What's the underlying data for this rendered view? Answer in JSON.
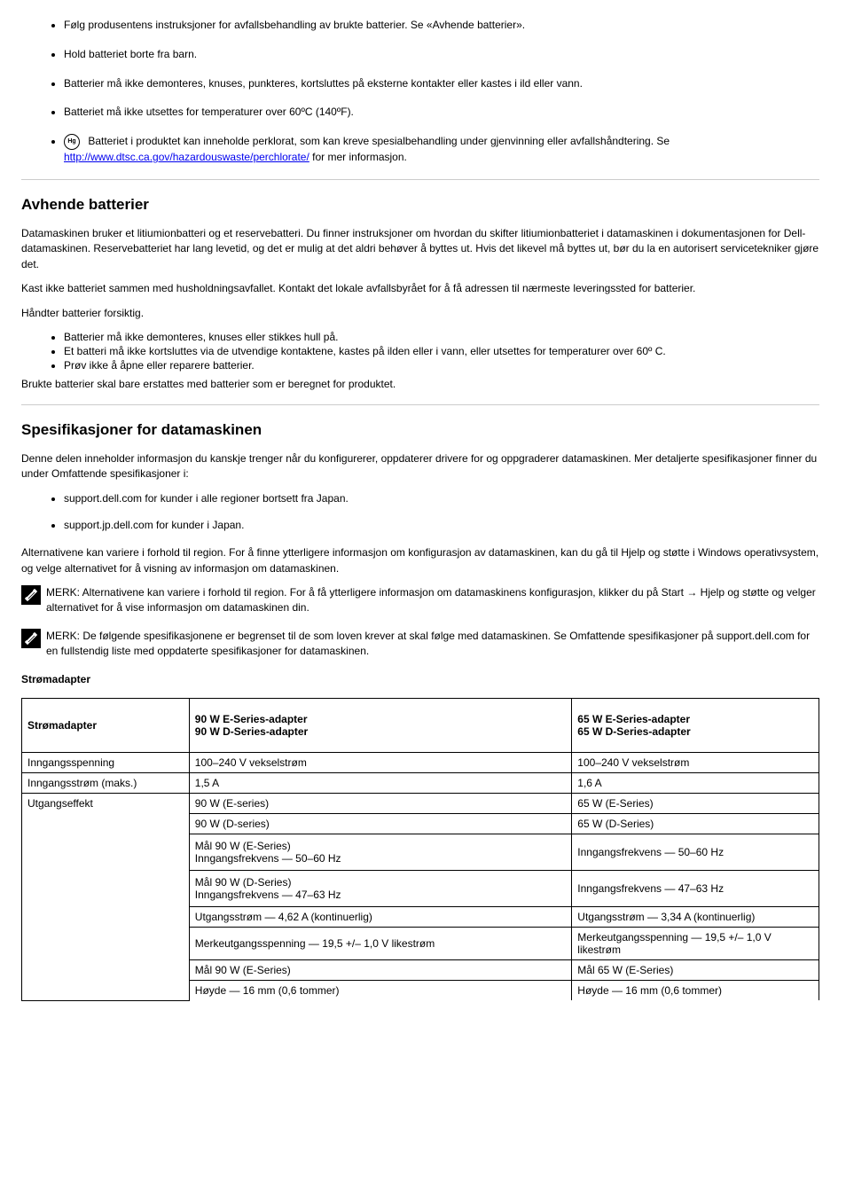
{
  "topList": {
    "item1_pre": "Følg produsentens instruksjoner for avfallsbehandling av brukte batterier. Se ",
    "item1_link_pre": "«",
    "item1_link": "Avhende batterier",
    "item1_link_post": "».",
    "item2": "Hold batteriet borte fra barn.",
    "item3": "Batterier må ikke demonteres, knuses, punkteres, kortsluttes på eksterne kontakter eller kastes i ild eller vann.",
    "item4": "Batteriet må ikke utsettes for temperaturer over 60ºC (140ºF).",
    "item5_pre": " Batteriet i produktet kan inneholde perklorat, som kan kreve spesialbehandling under gjenvinning eller avfallshåndtering. Se ",
    "item5_link": "http://www.dtsc.ca.gov/hazardouswaste/perchlorate/",
    "item5_post": " for mer informasjon.",
    "hg_label": "Hg"
  },
  "battDisposal": {
    "heading": "Avhende batterier",
    "p1": "Datamaskinen bruker et litiumionbatteri og et reservebatteri. Du finner instruksjoner om hvordan du skifter litiumionbatteriet i datamaskinen i dokumentasjonen for Dell-datamaskinen. Reservebatteriet har lang levetid, og det er mulig at det aldri behøver å byttes ut. Hvis det likevel må byttes ut, bør du la en autorisert servicetekniker gjøre det.",
    "p2": "Kast ikke batteriet sammen med husholdningsavfallet. Kontakt det lokale avfallsbyrået for å få adressen til nærmeste leveringssted for batterier.",
    "p3": "Håndter batterier forsiktig.",
    "sub": {
      "a": "Batterier må ikke demonteres, knuses eller stikkes hull på.",
      "b": "Et batteri må ikke kortsluttes via de utvendige kontaktene, kastes på ilden eller i vann, eller utsettes for temperaturer over 60º C.",
      "c": "Prøv ikke å åpne eller reparere batterier."
    },
    "p4": "Brukte batterier skal bare erstattes med batterier som er beregnet for produktet."
  },
  "compSpecs": {
    "heading": "Spesifikasjoner for datamaskinen",
    "p1": "Denne delen inneholder informasjon du kanskje trenger når du konfigurerer, oppdaterer drivere for og oppgraderer datamaskinen. Mer detaljerte spesifikasjoner finner du under Omfattende spesifikasjoner i:",
    "b1": "support.dell.com for kunder i alle regioner bortsett fra Japan.",
    "b2": "support.jp.dell.com for kunder i Japan.",
    "p2": "Alternativene kan variere i forhold til region. For å finne ytterligere informasjon om konfigurasjon av datamaskinen, kan du gå til Hjelp og støtte i Windows operativsystem, og velge alternativet for å visning av informasjon om datamaskinen.",
    "note1": "MERK: Alternativene kan variere i forhold til region. For å få ytterligere informasjon om datamaskinens konfigurasjon, klikker du på Start → Hjelp og støtte og velger alternativet for å vise informasjon om datamaskinen din.",
    "note2": "MERK: De følgende spesifikasjonene er begrenset til de som loven krever at skal følge med datamaskinen. Se Omfattende spesifikasjoner på support.dell.com for en fullstendig liste med oppdaterte spesifikasjoner for datamaskinen."
  },
  "acTable": {
    "heading": "Strømadapter",
    "headers": {
      "c1": "Strømadapter",
      "c2_l1": "90 W E-Series-adapter",
      "c2_l2": "90 W D-Series-adapter",
      "c3_l1": "65 W E-Series-adapter",
      "c3_l2": "65 W D-Series-adapter"
    },
    "rows": [
      {
        "a": "Inngangsspenning",
        "b": "100–240 V vekselstrøm",
        "c": "100–240 V vekselstrøm"
      },
      {
        "a": "Inngangsstrøm (maks.)",
        "b": "1,5 A",
        "c": "1,6 A"
      },
      {
        "a": "Utgangseffekt",
        "bc_rows": [
          {
            "b": "90 W (E-series)",
            "c": "65 W (E-Series)"
          },
          {
            "b": "90 W (D-series)",
            "c": "65 W (D-Series)"
          },
          {
            "b_l1": "Mål 90 W (E-Series)",
            "b_l2": "Inngangsfrekvens — 50–60 Hz",
            "c": "Inngangsfrekvens — 50–60 Hz"
          },
          {
            "b_l1": "Mål 90 W (D-Series)",
            "b_l2": "Inngangsfrekvens — 47–63 Hz",
            "c": "Inngangsfrekvens — 47–63 Hz"
          },
          {
            "b": "Utgangsstrøm — 4,62 A (kontinuerlig)",
            "c": "Utgangsstrøm — 3,34 A (kontinuerlig)"
          },
          {
            "b": "Merkeutgangsspenning — 19,5 +/– 1,0 V likestrøm",
            "c": "Merkeutgangsspenning — 19,5 +/– 1,0 V likestrøm"
          },
          {
            "b": "Mål 90 W (E-Series)",
            "c": "Mål 65 W (E-Series)"
          },
          {
            "b": "Høyde — 16 mm (0,6 tommer)",
            "c": "Høyde — 16 mm (0,6 tommer)"
          }
        ]
      }
    ]
  }
}
